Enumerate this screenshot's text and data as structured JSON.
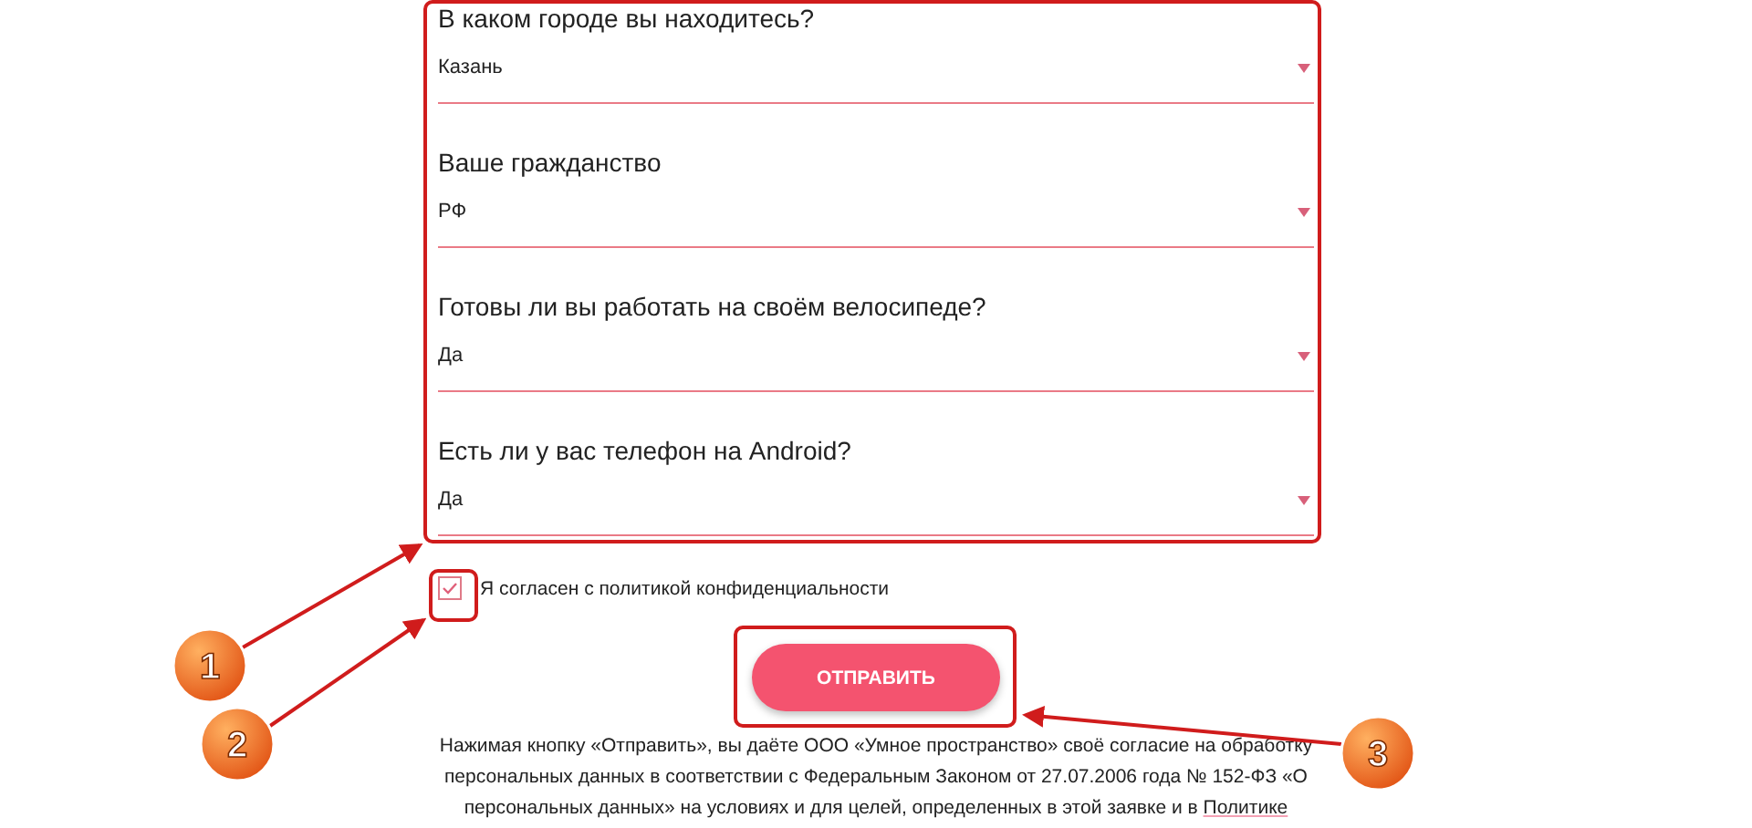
{
  "form": {
    "fields": [
      {
        "label": "В каком городе вы находитесь?",
        "value": "Казань"
      },
      {
        "label": "Ваше гражданство",
        "value": "РФ"
      },
      {
        "label": "Готовы ли вы работать на своём велосипеде?",
        "value": "Да"
      },
      {
        "label": "Есть ли у вас телефон на Android?",
        "value": "Да"
      }
    ]
  },
  "consent": {
    "label": "Я согласен с политикой конфиденциальности",
    "checked": true
  },
  "submit": {
    "label": "ОТПРАВИТЬ"
  },
  "disclaimer": {
    "text": "Нажимая кнопку «Отправить», вы даёте ООО «Умное пространство» своё согласие на обработку персональных данных в соответствии с Федеральным Законом от 27.07.2006 года № 152-ФЗ «О персональных данных» на условиях и для целей, определенных в этой заявке и в ",
    "link": "Политике"
  },
  "annotations": [
    {
      "number": "1"
    },
    {
      "number": "2"
    },
    {
      "number": "3"
    }
  ]
}
